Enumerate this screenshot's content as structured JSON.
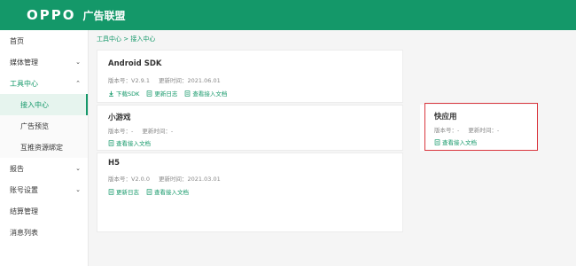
{
  "header": {
    "logo": "OPPO",
    "brand": "广告联盟"
  },
  "sidebar": {
    "items": [
      {
        "label": "首页"
      },
      {
        "label": "媒体管理",
        "chevron": "v"
      },
      {
        "label": "工具中心",
        "chevron": "^"
      },
      {
        "label": "接入中心"
      },
      {
        "label": "广告预览"
      },
      {
        "label": "互推资源绑定"
      },
      {
        "label": "报告",
        "chevron": "v"
      },
      {
        "label": "账号设置",
        "chevron": "v"
      },
      {
        "label": "结算管理"
      },
      {
        "label": "消息列表"
      }
    ]
  },
  "breadcrumb": {
    "part1": "工具中心",
    "sep": ">",
    "part2": "接入中心"
  },
  "cards": {
    "android": {
      "title": "Android SDK",
      "version_label": "版本号：V2.9.1",
      "update_label": "更新时间：2021.06.01",
      "links": [
        "下载SDK",
        "更新日志",
        "查看接入文档"
      ]
    },
    "minigame": {
      "title": "小游戏",
      "version_label": "版本号：-",
      "update_label": "更新时间：-",
      "links": [
        "查看接入文档"
      ]
    },
    "quickapp": {
      "title": "快应用",
      "version_label": "版本号：-",
      "update_label": "更新时间：-",
      "links": [
        "查看接入文档"
      ]
    },
    "h5": {
      "title": "H5",
      "version_label": "版本号：V2.0.0",
      "update_label": "更新时间：2021.03.01",
      "links": [
        "更新日志",
        "查看接入文档"
      ]
    }
  },
  "colors": {
    "brand_green": "#149869",
    "highlight_red": "#d9363e"
  }
}
